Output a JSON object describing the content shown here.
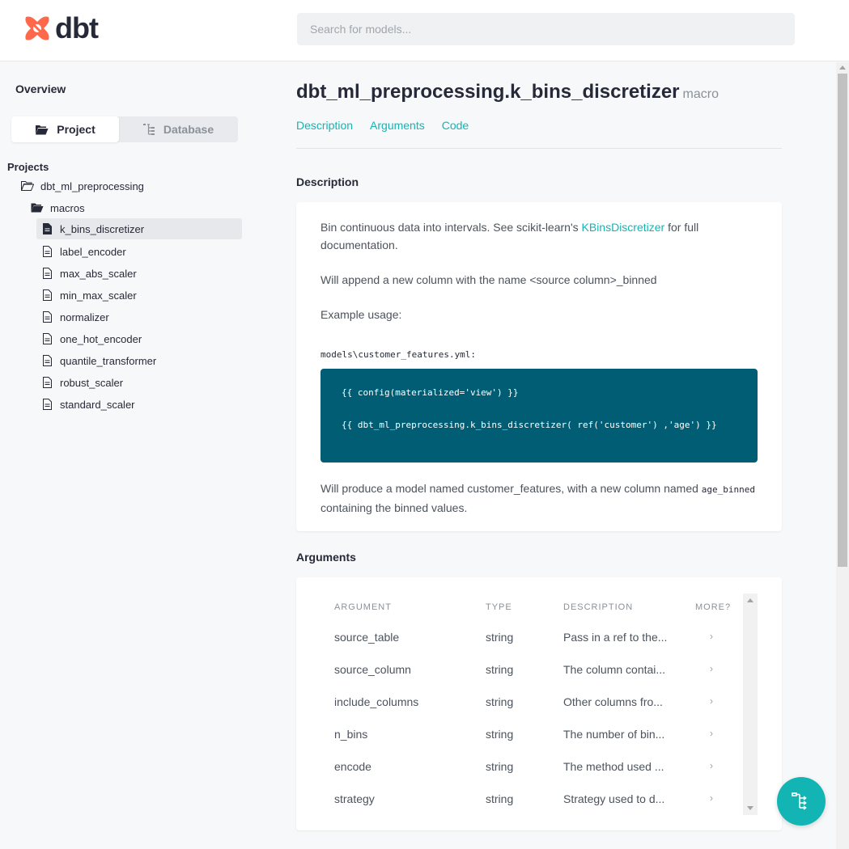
{
  "header": {
    "logo_text": "dbt",
    "search_placeholder": "Search for models..."
  },
  "sidebar": {
    "overview_label": "Overview",
    "toggle": {
      "project_label": "Project",
      "database_label": "Database",
      "active": "Project"
    },
    "projects_label": "Projects",
    "project_name": "dbt_ml_preprocessing",
    "folder_name": "macros",
    "selected": "k_bins_discretizer",
    "items": [
      "k_bins_discretizer",
      "label_encoder",
      "max_abs_scaler",
      "min_max_scaler",
      "normalizer",
      "one_hot_encoder",
      "quantile_transformer",
      "robust_scaler",
      "standard_scaler"
    ]
  },
  "main": {
    "title": "dbt_ml_preprocessing.k_bins_discretizer",
    "kind": "macro",
    "tabs": [
      "Description",
      "Arguments",
      "Code"
    ],
    "description_heading": "Description",
    "description": {
      "line1_before": "Bin continuous data into intervals. See scikit-learn's ",
      "line1_link": "KBinsDiscretizer",
      "line1_after": " for full",
      "line1_cont": "documentation.",
      "line2": "Will append a new column with the name <source column>_binned",
      "line3": "Example usage:",
      "code_file": "models\\customer_features.yml:",
      "code_line1": "{{ config(materialized='view') }}",
      "code_line2": "{{ dbt_ml_preprocessing.k_bins_discretizer( ref('customer') ,'age') }}",
      "line4_before": "Will produce a model named customer_features, with a new column named ",
      "line4_code": "age_binned",
      "line4_cont": "containing the binned values."
    },
    "arguments_heading": "Arguments",
    "arguments": {
      "columns": [
        "ARGUMENT",
        "TYPE",
        "DESCRIPTION",
        "MORE?"
      ],
      "rows": [
        {
          "name": "source_table",
          "type": "string",
          "desc": "Pass in a ref to the..."
        },
        {
          "name": "source_column",
          "type": "string",
          "desc": "The column contai..."
        },
        {
          "name": "include_columns",
          "type": "string",
          "desc": "Other columns fro..."
        },
        {
          "name": "n_bins",
          "type": "string",
          "desc": "The number of bin..."
        },
        {
          "name": "encode",
          "type": "string",
          "desc": "The method used ..."
        },
        {
          "name": "strategy",
          "type": "string",
          "desc": "Strategy used to d..."
        }
      ],
      "more_glyph": "›"
    }
  },
  "colors": {
    "accent": "#13b5b4",
    "code_bg": "#005d74",
    "logo": "#ff694b"
  },
  "icons": {
    "fab": "lineage-graph-icon"
  }
}
